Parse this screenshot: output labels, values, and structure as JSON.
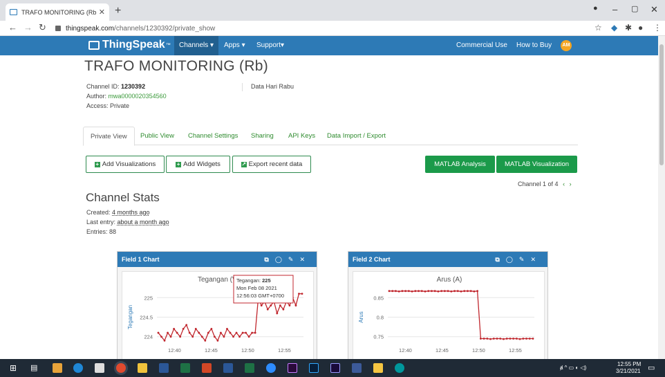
{
  "browser": {
    "tab_title": "TRAFO MONITORING (Rb) - Thin",
    "url_host": "thingspeak.com",
    "url_path": "/channels/1230392/private_show"
  },
  "nav": {
    "logo": "ThingSpeak",
    "logo_tm": "™",
    "channels": "Channels ▾",
    "apps": "Apps ▾",
    "support": "Support▾",
    "commercial": "Commercial Use",
    "how_to_buy": "How to Buy",
    "avatar": "AM"
  },
  "channel": {
    "title": "TRAFO MONITORING (Rb)",
    "id_label": "Channel ID: ",
    "id": "1230392",
    "author_label": "Author: ",
    "author": "mwa0000020354560",
    "access": "Access: Private",
    "description": "Data Hari Rabu"
  },
  "tabs": [
    "Private View",
    "Public View",
    "Channel Settings",
    "Sharing",
    "API Keys",
    "Data Import / Export"
  ],
  "buttons": {
    "add_vis": "Add Visualizations",
    "add_widgets": "Add Widgets",
    "export": "Export recent data",
    "matlab_analysis": "MATLAB Analysis",
    "matlab_vis": "MATLAB Visualization"
  },
  "channel_nav": "Channel 1 of 4",
  "stats": {
    "heading": "Channel Stats",
    "created_label": "Created: ",
    "created": "4 months ago",
    "last_label": "Last entry: ",
    "last": "about a month ago",
    "entries": "Entries: 88"
  },
  "colors": {
    "nav": "#2d7ab6",
    "green": "#1b9a4a",
    "series": "#c0262d"
  },
  "chart_data": [
    {
      "type": "line",
      "panel_title": "Field 1 Chart",
      "title": "Tegangan (V)",
      "ylabel": "Tegangan",
      "yticks": [
        "225",
        "224.5",
        "224"
      ],
      "xticks": [
        "12:40",
        "12:45",
        "12:50",
        "12:55"
      ],
      "ylim": [
        223.8,
        225.2
      ],
      "values": [
        224.1,
        224.0,
        223.9,
        224.1,
        224.0,
        224.2,
        224.1,
        224.0,
        224.2,
        224.3,
        224.1,
        224.0,
        224.2,
        224.1,
        224.0,
        223.9,
        224.1,
        224.2,
        224.0,
        223.9,
        224.1,
        224.0,
        224.2,
        224.1,
        224.0,
        224.1,
        224.0,
        224.1,
        224.1,
        224.0,
        224.1,
        224.1,
        225.0,
        224.8,
        224.9,
        224.7,
        224.8,
        224.9,
        224.6,
        224.8,
        224.7,
        224.9,
        224.8,
        225.0,
        224.8,
        225.1,
        225.1
      ],
      "tooltip": {
        "line1_label": "Tegangan: ",
        "line1_value": "225",
        "line2": "Mon Feb 08 2021",
        "line3": "12:56:03 GMT+0700"
      }
    },
    {
      "type": "line",
      "panel_title": "Field 2 Chart",
      "title": "Arus (A)",
      "ylabel": "Arus",
      "yticks": [
        "0.85",
        "0.8",
        "0.75"
      ],
      "xticks": [
        "12:40",
        "12:45",
        "12:50",
        "12:55"
      ],
      "ylim": [
        0.73,
        0.87
      ],
      "values": [
        0.867,
        0.867,
        0.867,
        0.866,
        0.867,
        0.867,
        0.867,
        0.866,
        0.867,
        0.867,
        0.867,
        0.866,
        0.867,
        0.867,
        0.867,
        0.866,
        0.867,
        0.867,
        0.867,
        0.866,
        0.867,
        0.867,
        0.866,
        0.867,
        0.867,
        0.867,
        0.866,
        0.867,
        0.745,
        0.745,
        0.745,
        0.744,
        0.745,
        0.745,
        0.745,
        0.744,
        0.745,
        0.745,
        0.745,
        0.745,
        0.744,
        0.745,
        0.745,
        0.745,
        0.745
      ]
    }
  ],
  "taskbar": {
    "time": "12:55 PM",
    "date": "3/21/2021"
  }
}
